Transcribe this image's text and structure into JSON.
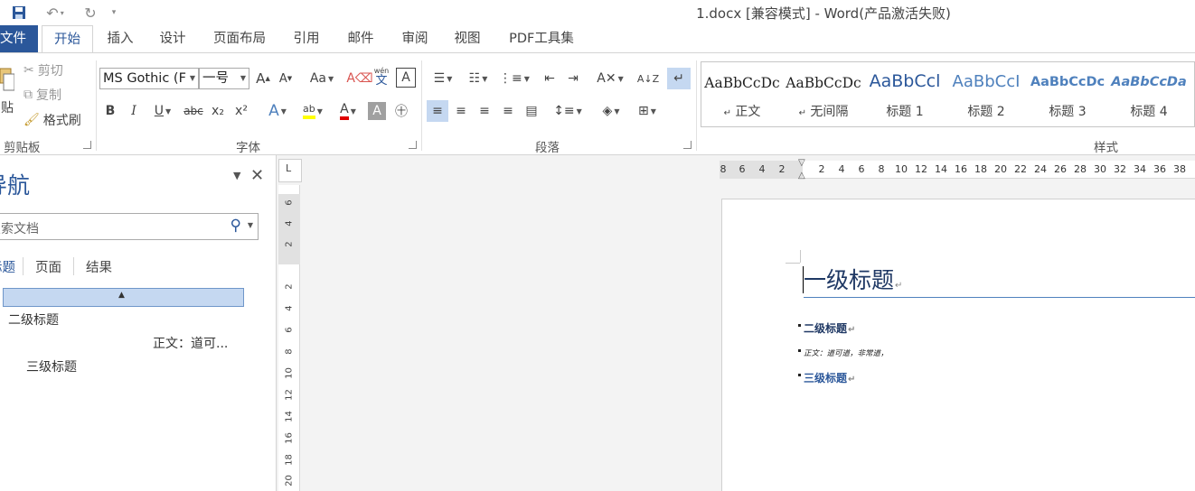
{
  "title_bar": {
    "title": "1.docx [兼容模式] - Word(产品激活失败)"
  },
  "tabs": [
    "文件",
    "开始",
    "插入",
    "设计",
    "页面布局",
    "引用",
    "邮件",
    "审阅",
    "视图",
    "PDF工具集"
  ],
  "ribbon": {
    "clipboard": {
      "paste": "贴",
      "cut": "剪切",
      "copy": "复制",
      "format_painter": "格式刷",
      "label": "剪贴板"
    },
    "font": {
      "font_name": "MS Gothic (F",
      "font_size": "一号",
      "change_case": "Aa",
      "phonetic_top": "wén",
      "phonetic_bottom": "文",
      "bold": "B",
      "italic": "I",
      "underline": "U",
      "strikethrough": "abc",
      "subscript": "x₂",
      "superscript": "x²",
      "label": "字体"
    },
    "paragraph": {
      "label": "段落"
    },
    "styles": {
      "items": [
        {
          "sample": "AaBbCcDc",
          "name": "正文"
        },
        {
          "sample": "AaBbCcDc",
          "name": "无间隔"
        },
        {
          "sample": "AaBbCcl",
          "name": "标题 1"
        },
        {
          "sample": "AaBbCcI",
          "name": "标题 2"
        },
        {
          "sample": "AaBbCcDc",
          "name": "标题 3"
        },
        {
          "sample": "AaBbCcDa",
          "name": "标题 4"
        }
      ],
      "label": "样式"
    }
  },
  "nav_pane": {
    "title": "导航",
    "search_placeholder": "搜索文档",
    "tabs": [
      "标题",
      "页面",
      "结果"
    ],
    "items": [
      "二级标题",
      "正文：道可...",
      "三级标题"
    ]
  },
  "rulers": {
    "horizontal_ticks": [
      "8",
      "6",
      "4",
      "2",
      "2",
      "4",
      "6",
      "8",
      "10",
      "12",
      "14",
      "16",
      "18",
      "20",
      "22",
      "24",
      "26",
      "28",
      "30",
      "32",
      "34",
      "36",
      "38"
    ],
    "vertical_ticks_top": [
      "6",
      "4",
      "2"
    ],
    "vertical_ticks": [
      "2",
      "4",
      "6",
      "8",
      "10",
      "12",
      "14",
      "16",
      "18",
      "20"
    ]
  },
  "document": {
    "heading1": "一级标题",
    "heading2": "二级标题",
    "body_text": "正文：道可道，非常道，",
    "heading3": "三级标题",
    "pilcrow": "↵"
  }
}
